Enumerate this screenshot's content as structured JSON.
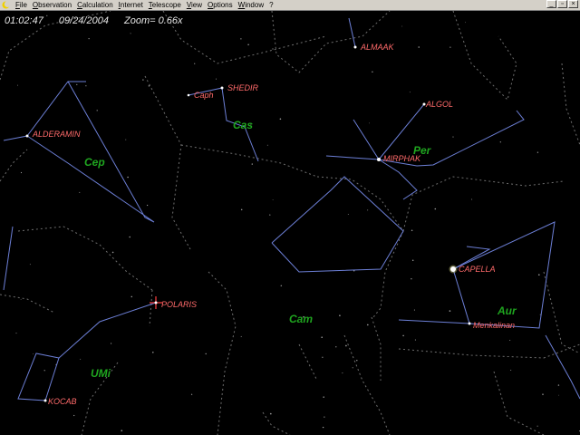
{
  "app": {
    "icon": "moon-icon",
    "menus": [
      "File",
      "Observation",
      "Calculation",
      "Internet",
      "Telescope",
      "View",
      "Options",
      "Window",
      "?"
    ]
  },
  "window_controls": {
    "minimize": "_",
    "restore": "▫",
    "close": "×"
  },
  "status": {
    "time": "01:02:47",
    "date": "09/24/2004",
    "zoom": "Zoom= 0.66x"
  },
  "colors": {
    "background": "#000000",
    "star_label": "#ff6a6a",
    "constellation_label": "#1fa51f",
    "constellation_line": "#6c7fd6",
    "boundary": "#6e6e6e",
    "star": "#ffffff",
    "polaris_marker": "#ff4040"
  },
  "stars": [
    {
      "name": "ALMAAK"
    },
    {
      "name": "SHEDIR"
    },
    {
      "name": "Caph"
    },
    {
      "name": "ALGOL"
    },
    {
      "name": "ALDERAMIN"
    },
    {
      "name": "MIRPHAK"
    },
    {
      "name": "CAPELLA"
    },
    {
      "name": "POLARIS"
    },
    {
      "name": "Menkalinan"
    },
    {
      "name": "KOCAB"
    }
  ],
  "constellations": [
    {
      "name": "Cas"
    },
    {
      "name": "Cep"
    },
    {
      "name": "Per"
    },
    {
      "name": "Cam"
    },
    {
      "name": "Aur"
    },
    {
      "name": "UMi"
    }
  ]
}
